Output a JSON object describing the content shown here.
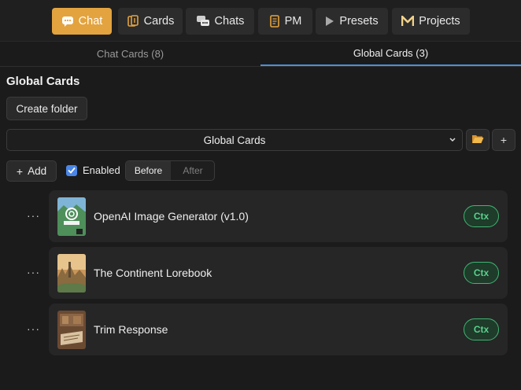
{
  "nav": [
    {
      "label": "Chat",
      "icon": "chat-bubble-icon",
      "active": true
    },
    {
      "label": "Cards",
      "icon": "cards-icon",
      "active": false
    },
    {
      "label": "Chats",
      "icon": "chats-icon",
      "active": false
    },
    {
      "label": "PM",
      "icon": "scroll-icon",
      "active": false
    },
    {
      "label": "Presets",
      "icon": "play-icon",
      "active": false
    },
    {
      "label": "Projects",
      "icon": "m-logo-icon",
      "active": false
    }
  ],
  "tabs": [
    {
      "label": "Chat Cards (8)",
      "active": false
    },
    {
      "label": "Global Cards (3)",
      "active": true
    }
  ],
  "section_title": "Global Cards",
  "create_folder_label": "Create folder",
  "folder_select": {
    "selected": "Global Cards"
  },
  "add_label": "Add",
  "enabled": {
    "label": "Enabled",
    "checked": true
  },
  "position_toggle": {
    "options": [
      "Before",
      "After"
    ],
    "selected": "Before"
  },
  "cards": [
    {
      "name": "OpenAI Image Generator (v1.0)",
      "badge": "Ctx",
      "thumb_text": "GENERATE IMAGES",
      "thumb_brand": "OpenAI"
    },
    {
      "name": "The Continent Lorebook",
      "badge": "Ctx"
    },
    {
      "name": "Trim Response",
      "badge": "Ctx"
    }
  ],
  "colors": {
    "accent": "#e3a33f",
    "tab_underline": "#4d8fd8",
    "ctx_green": "#59d18e",
    "checkbox": "#4a86e8"
  }
}
